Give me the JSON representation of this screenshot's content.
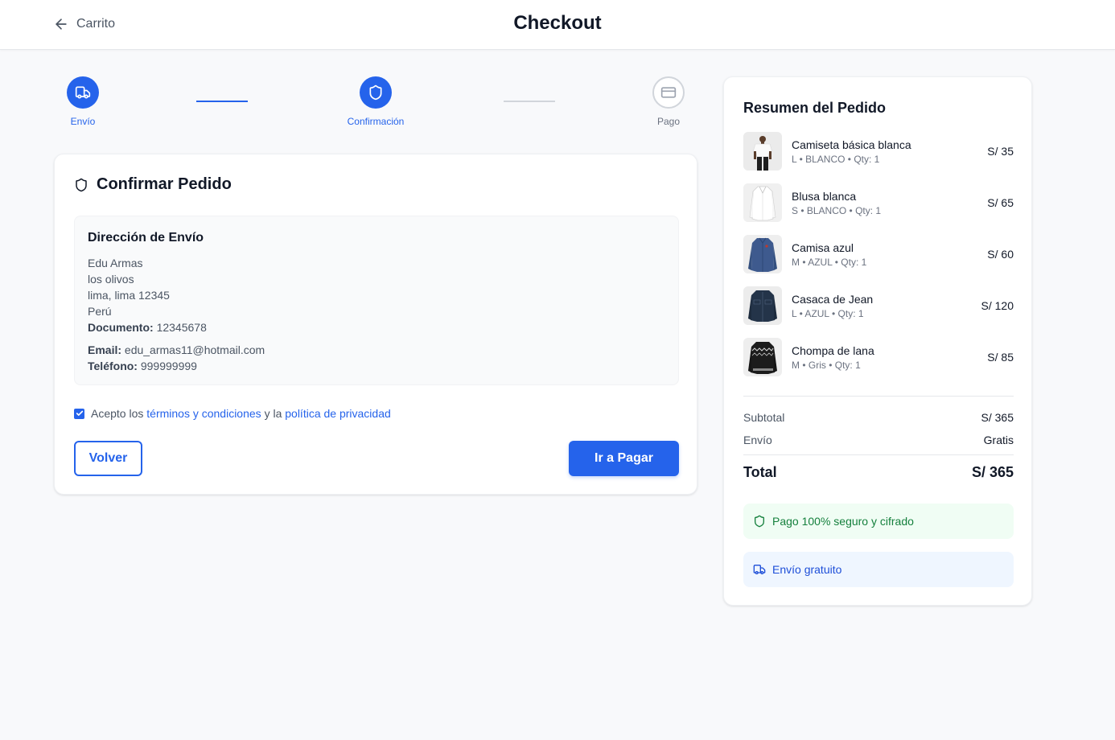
{
  "header": {
    "back_label": "Carrito",
    "title": "Checkout"
  },
  "stepper": {
    "steps": [
      {
        "label": "Envío",
        "state": "complete",
        "icon": "truck-icon"
      },
      {
        "label": "Confirmación",
        "state": "active",
        "icon": "shield-icon"
      },
      {
        "label": "Pago",
        "state": "pending",
        "icon": "credit-card-icon"
      }
    ]
  },
  "confirm": {
    "title": "Confirmar Pedido",
    "address": {
      "heading": "Dirección de Envío",
      "name": "Edu Armas",
      "street": "los olivos",
      "city_line": "lima, lima 12345",
      "country": "Perú",
      "document_label": "Documento:",
      "document_value": "12345678",
      "email_label": "Email:",
      "email_value": "edu_armas11@hotmail.com",
      "phone_label": "Teléfono:",
      "phone_value": "999999999"
    },
    "terms": {
      "checked": true,
      "prefix": "Acepto los",
      "terms_link": "términos y condiciones",
      "middle": "y la",
      "privacy_link": "política de privacidad"
    },
    "back_button": "Volver",
    "pay_button": "Ir a Pagar"
  },
  "summary": {
    "title": "Resumen del Pedido",
    "items": [
      {
        "name": "Camiseta básica blanca",
        "meta": "L • BLANCO • Qty: 1",
        "price": "S/ 35",
        "thumb": "white-tshirt"
      },
      {
        "name": "Blusa blanca",
        "meta": "S • BLANCO • Qty: 1",
        "price": "S/ 65",
        "thumb": "white-blouse"
      },
      {
        "name": "Camisa azul",
        "meta": "M • AZUL • Qty: 1",
        "price": "S/ 60",
        "thumb": "blue-shirt"
      },
      {
        "name": "Casaca de Jean",
        "meta": "L • AZUL • Qty: 1",
        "price": "S/ 120",
        "thumb": "denim-jacket"
      },
      {
        "name": "Chompa de lana",
        "meta": "M • Gris • Qty: 1",
        "price": "S/ 85",
        "thumb": "wool-sweater"
      }
    ],
    "subtotal_label": "Subtotal",
    "subtotal_value": "S/ 365",
    "shipping_label": "Envío",
    "shipping_value": "Gratis",
    "total_label": "Total",
    "total_value": "S/ 365",
    "secure_badge": "Pago 100% seguro y cifrado",
    "shipping_badge": "Envío gratuito"
  },
  "colors": {
    "accent": "#2563eb",
    "success": "#15803d",
    "background": "#f8f9fb"
  }
}
